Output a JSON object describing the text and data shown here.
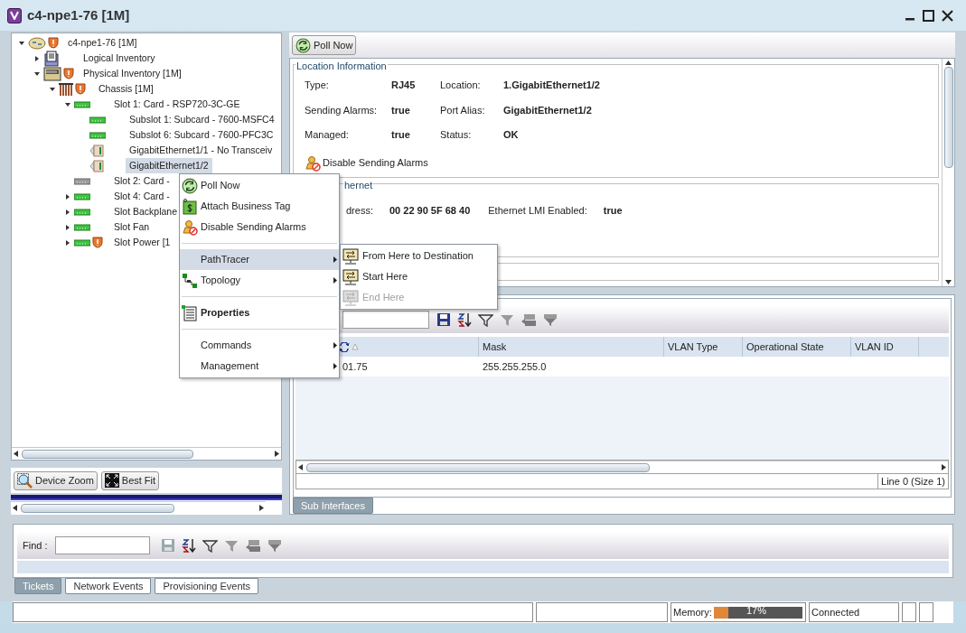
{
  "window": {
    "title": "c4-npe1-76 [1M]"
  },
  "tree": [
    {
      "label": "c4-npe1-76 [1M]",
      "kind": "router",
      "alarm": true,
      "expanded": true,
      "selected": false,
      "children": [
        {
          "label": "Logical Inventory",
          "kind": "document",
          "alarm": false,
          "expanded": false,
          "selected": false
        },
        {
          "label": "Physical Inventory [1M]",
          "kind": "rack",
          "alarm": true,
          "expanded": true,
          "selected": false,
          "children": [
            {
              "label": "Chassis [1M]",
              "kind": "chassis",
              "alarm": true,
              "expanded": true,
              "selected": false,
              "children": [
                {
                  "label": "Slot 1: Card - RSP720-3C-GE",
                  "kind": "card",
                  "alarm": false,
                  "expanded": true,
                  "selected": false,
                  "children": [
                    {
                      "label": "Subslot 1: Subcard - 7600-MSFC4",
                      "kind": "card",
                      "alarm": false,
                      "selected": false
                    },
                    {
                      "label": "Subslot 6: Subcard - 7600-PFC3C",
                      "kind": "card",
                      "alarm": false,
                      "selected": false
                    },
                    {
                      "label": "GigabitEthernet1/1 - No Transceiv",
                      "kind": "port",
                      "alarm": false,
                      "selected": false
                    },
                    {
                      "label": "GigabitEthernet1/2",
                      "kind": "port",
                      "alarm": false,
                      "selected": true
                    }
                  ]
                },
                {
                  "label": "Slot 2: Card -",
                  "kind": "inactive",
                  "alarm": false,
                  "selected": false
                },
                {
                  "label": "Slot 4: Card -",
                  "kind": "card",
                  "alarm": false,
                  "expanded": false,
                  "selected": false
                },
                {
                  "label": "Slot Backplane",
                  "kind": "card",
                  "alarm": false,
                  "expanded": false,
                  "selected": false
                },
                {
                  "label": "Slot Fan",
                  "kind": "card",
                  "alarm": false,
                  "expanded": false,
                  "selected": false
                },
                {
                  "label": "Slot Power [1",
                  "kind": "card",
                  "alarm": true,
                  "expanded": false,
                  "selected": false
                }
              ]
            }
          ]
        }
      ]
    }
  ],
  "left_buttons": [
    "Device Zoom",
    "Best Fit"
  ],
  "toolbar": {
    "poll_button": "Poll Now"
  },
  "location": {
    "legend": "Location Information",
    "fields": [
      {
        "label": "Type:",
        "value": "RJ45"
      },
      {
        "label": "Location:",
        "value": "1.GigabitEthernet1/2"
      },
      {
        "label": "Sending Alarms:",
        "value": "true"
      },
      {
        "label": "Port Alias:",
        "value": "GigabitEthernet1/2"
      },
      {
        "label": "Managed:",
        "value": "true"
      },
      {
        "label": "Status:",
        "value": "OK"
      }
    ],
    "action": "Disable Sending Alarms"
  },
  "ethernet": {
    "legend": "hernet",
    "fields": [
      {
        "label": "dress:",
        "value": "00 22 90 5F 68 40"
      },
      {
        "label": "Ethernet LMI Enabled:",
        "value": "true"
      }
    ]
  },
  "sub_table": {
    "columns": [
      {
        "sorted": true
      },
      {
        "label": "Mask",
        "sorted": false
      },
      {
        "label": "VLAN Type",
        "sorted": false
      },
      {
        "label": "Operational State",
        "sorted": false
      },
      {
        "label": "VLAN ID",
        "sorted": false
      }
    ],
    "rows": [
      [
        "01.75",
        "255.255.255.0"
      ]
    ],
    "status": "Line 0 (Size 1)",
    "tabs": [
      {
        "label": "Sub Interfaces",
        "selected": true
      }
    ]
  },
  "context_menu": [
    {
      "kind": "item",
      "label": "Poll Now",
      "selected": false
    },
    {
      "kind": "item",
      "label": "Attach Business Tag",
      "selected": false
    },
    {
      "kind": "item",
      "label": "Disable Sending Alarms",
      "selected": false
    },
    {
      "kind": "separator"
    },
    {
      "kind": "submenu",
      "label": "PathTracer",
      "selected": true
    },
    {
      "kind": "submenu",
      "label": "Topology",
      "selected": false
    },
    {
      "kind": "separator"
    },
    {
      "kind": "default",
      "label": "Properties",
      "selected": false
    },
    {
      "kind": "separator"
    },
    {
      "kind": "submenu",
      "label": "Commands",
      "selected": false
    },
    {
      "kind": "submenu",
      "label": "Management",
      "selected": false
    }
  ],
  "submenu": [
    {
      "label": "From Here to Destination",
      "disabled": false
    },
    {
      "label": "Start Here",
      "disabled": false
    },
    {
      "label": "End Here",
      "disabled": true
    }
  ],
  "events": {
    "find_label": "Find :",
    "tabs": [
      {
        "label": "Tickets",
        "selected": true
      },
      {
        "label": "Network Events",
        "selected": false
      },
      {
        "label": "Provisioning Events",
        "selected": false
      }
    ]
  },
  "status_bar": {
    "memory_label": "Memory:",
    "memory": {
      "level": 0.17,
      "reading": "17%"
    },
    "connection": "Connected"
  }
}
